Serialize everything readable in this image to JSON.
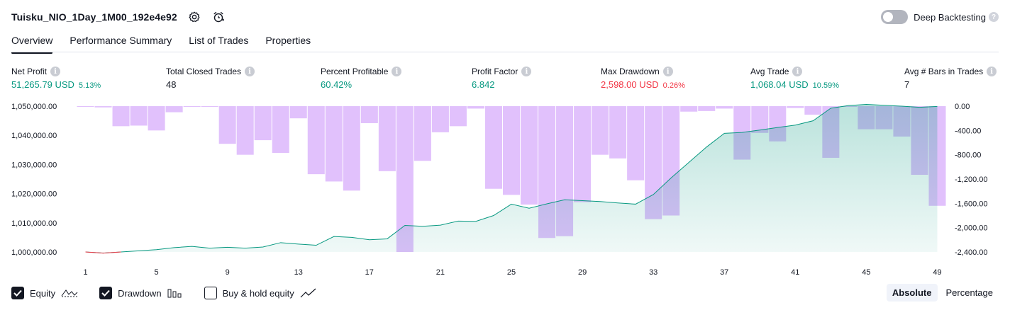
{
  "header": {
    "title": "Tuisku_NIO_1Day_1M00_192e4e92",
    "deep_backtesting_label": "Deep Backtesting",
    "help": "?"
  },
  "tabs": [
    {
      "label": "Overview",
      "active": true
    },
    {
      "label": "Performance Summary",
      "active": false
    },
    {
      "label": "List of Trades",
      "active": false
    },
    {
      "label": "Properties",
      "active": false
    }
  ],
  "metrics": {
    "info": "i",
    "net_profit": {
      "label": "Net Profit",
      "value": "51,265.79 USD",
      "pct": "5.13%"
    },
    "total_closed_trades": {
      "label": "Total Closed Trades",
      "value": "48"
    },
    "percent_profitable": {
      "label": "Percent Profitable",
      "value": "60.42%"
    },
    "profit_factor": {
      "label": "Profit Factor",
      "value": "6.842"
    },
    "max_drawdown": {
      "label": "Max Drawdown",
      "value": "2,598.00 USD",
      "pct": "0.26%"
    },
    "avg_trade": {
      "label": "Avg Trade",
      "value": "1,068.04 USD",
      "pct": "10.59%"
    },
    "avg_bars": {
      "label": "Avg # Bars in Trades",
      "value": "7"
    }
  },
  "footer": {
    "equity_label": "Equity",
    "drawdown_label": "Drawdown",
    "buyhold_label": "Buy & hold equity",
    "absolute_label": "Absolute",
    "percentage_label": "Percentage"
  },
  "colors": {
    "equity_line": "#089981",
    "equity_fill": "#089981",
    "equity_negative": "#f23645",
    "drawdown_bar": "#cf9bfa"
  },
  "chart_data": {
    "type": "bar",
    "x_ticks": [
      1,
      5,
      9,
      13,
      17,
      21,
      25,
      29,
      33,
      37,
      41,
      45,
      49
    ],
    "x_range": [
      1,
      49
    ],
    "left_axis": {
      "ticks": [
        "1,050,000.00",
        "1,040,000.00",
        "1,030,000.00",
        "1,020,000.00",
        "1,010,000.00",
        "1,000,000.00"
      ],
      "range": [
        1000000,
        1050000
      ]
    },
    "right_axis": {
      "ticks": [
        "0.00",
        "-400.00",
        "-800.00",
        "-1,200.00",
        "-1,600.00",
        "-2,000.00",
        "-2,400.00"
      ],
      "range": [
        -2400,
        0
      ]
    },
    "series": [
      {
        "name": "Equity",
        "type": "area",
        "values": [
          1000000,
          999600,
          1000000,
          1000400,
          1000800,
          1001500,
          1001900,
          1001300,
          1001600,
          1001300,
          1001700,
          1003200,
          1002700,
          1002300,
          1005300,
          1005000,
          1004200,
          1004500,
          1009100,
          1008800,
          1009200,
          1010600,
          1010500,
          1012500,
          1016400,
          1015000,
          1016500,
          1017900,
          1017600,
          1017300,
          1016800,
          1016400,
          1019700,
          1025400,
          1030700,
          1036000,
          1040700,
          1041000,
          1041800,
          1042700,
          1043500,
          1045000,
          1049300,
          1050200,
          1050600,
          1050300,
          1050000,
          1049600,
          1049900
        ]
      },
      {
        "name": "Drawdown",
        "type": "bar",
        "values": [
          -10,
          -20,
          -330,
          -320,
          -400,
          -100,
          -10,
          -10,
          -620,
          -800,
          -560,
          -770,
          -200,
          -1120,
          -1240,
          -1390,
          -280,
          -1070,
          -2400,
          -900,
          -430,
          -330,
          -40,
          -1360,
          -1460,
          -1620,
          -2170,
          -2140,
          -1580,
          -800,
          -860,
          -1220,
          -1860,
          -1800,
          -90,
          -80,
          -40,
          -880,
          -440,
          -580,
          -30,
          -140,
          -850,
          -10,
          -380,
          -380,
          -500,
          -1130,
          -1640
        ]
      }
    ]
  }
}
